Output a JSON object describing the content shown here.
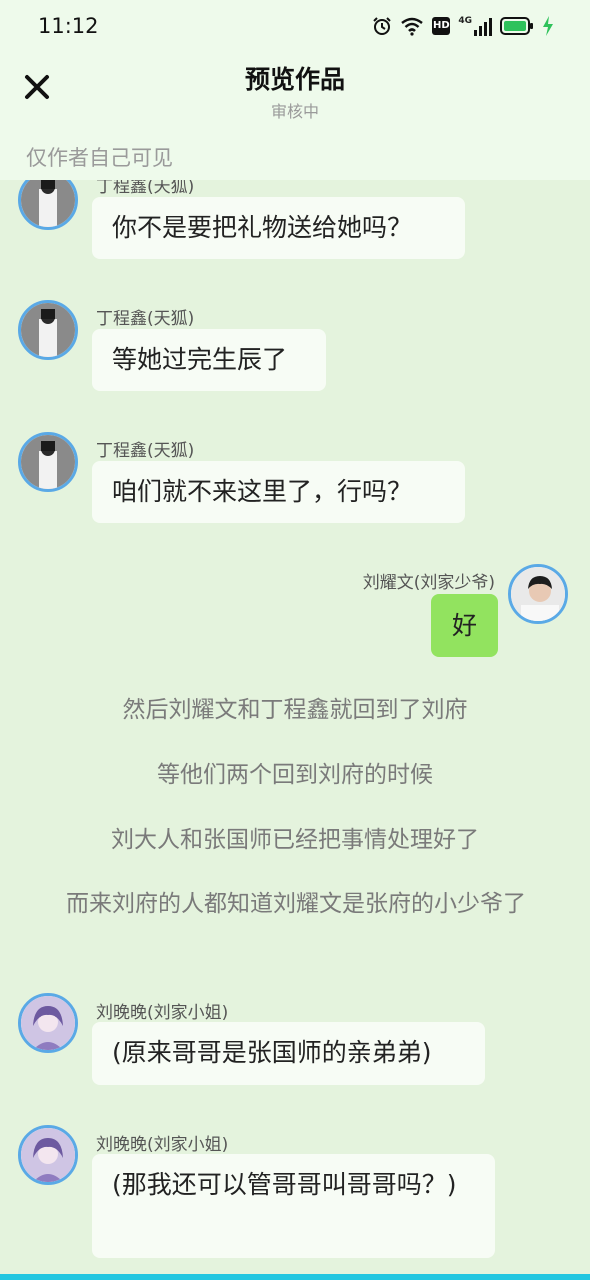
{
  "status_bar": {
    "time": "11:12",
    "icons": [
      "alarm-icon",
      "wifi-icon",
      "hd-icon",
      "signal-4g-icon",
      "battery-icon",
      "charging-icon"
    ],
    "network_label": "4G",
    "hd_label": "HD"
  },
  "header": {
    "title": "预览作品",
    "subtitle": "审核中",
    "close_icon": "close-icon"
  },
  "notice": "仅作者自己可见",
  "messages": [
    {
      "sender": "丁程鑫(天狐)",
      "text": "你不是要把礼物送给她吗？"
    },
    {
      "sender": "丁程鑫(天狐)",
      "text": "等她过完生辰了"
    },
    {
      "sender": "丁程鑫(天狐)",
      "text": "咱们就不来这里了，行吗？"
    },
    {
      "sender": "刘耀文(刘家少爷)",
      "text": "好"
    },
    {
      "sender": "刘晚晚(刘家小姐)",
      "text": "(原来哥哥是张国师的亲弟弟)"
    },
    {
      "sender": "刘晚晚(刘家小姐)",
      "text": "(那我还可以管哥哥叫哥哥吗？)"
    }
  ],
  "narrations": [
    "然后刘耀文和丁程鑫就回到了刘府",
    "等他们两个回到刘府的时候",
    "刘大人和张国师已经把事情处理好了",
    "而来刘府的人都知道刘耀文是张府的小少爷了"
  ],
  "colors": {
    "background": "#e4f3dd",
    "header_background": "#eefaeb",
    "bubble_other": "#f7fcf5",
    "bubble_mine": "#92e35f",
    "avatar_border": "#5aa9e6",
    "muted_text": "#9a9a9a"
  }
}
